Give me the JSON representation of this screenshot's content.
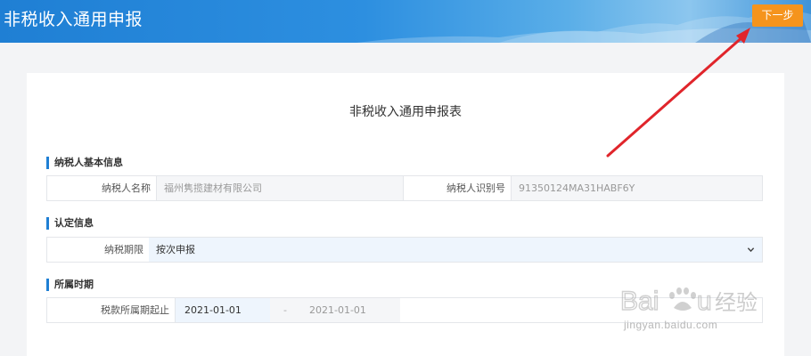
{
  "header": {
    "title": "非税收入通用申报",
    "next_button": "下一步"
  },
  "form": {
    "title": "非税收入通用申报表",
    "sections": {
      "taxpayer": "纳税人基本信息",
      "recognition": "认定信息",
      "period": "所属时期"
    },
    "taxpayer_name_label": "纳税人名称",
    "taxpayer_name_value": "福州隽揽建材有限公司",
    "taxpayer_id_label": "纳税人识别号",
    "taxpayer_id_value": "91350124MA31HABF6Y",
    "tax_period_label": "纳税期限",
    "tax_period_value": "按次申报",
    "period_start_label": "税款所属期起止",
    "period_start_value": "2021-01-01",
    "period_separator": "-",
    "period_end_value": "2021-01-01"
  },
  "watermark": {
    "logo_text": "Baidu经验",
    "url": "jingyan.baidu.com"
  },
  "colors": {
    "header_blue": "#1f7fd4",
    "button_orange": "#f5941d",
    "arrow_red": "#e0252b"
  }
}
